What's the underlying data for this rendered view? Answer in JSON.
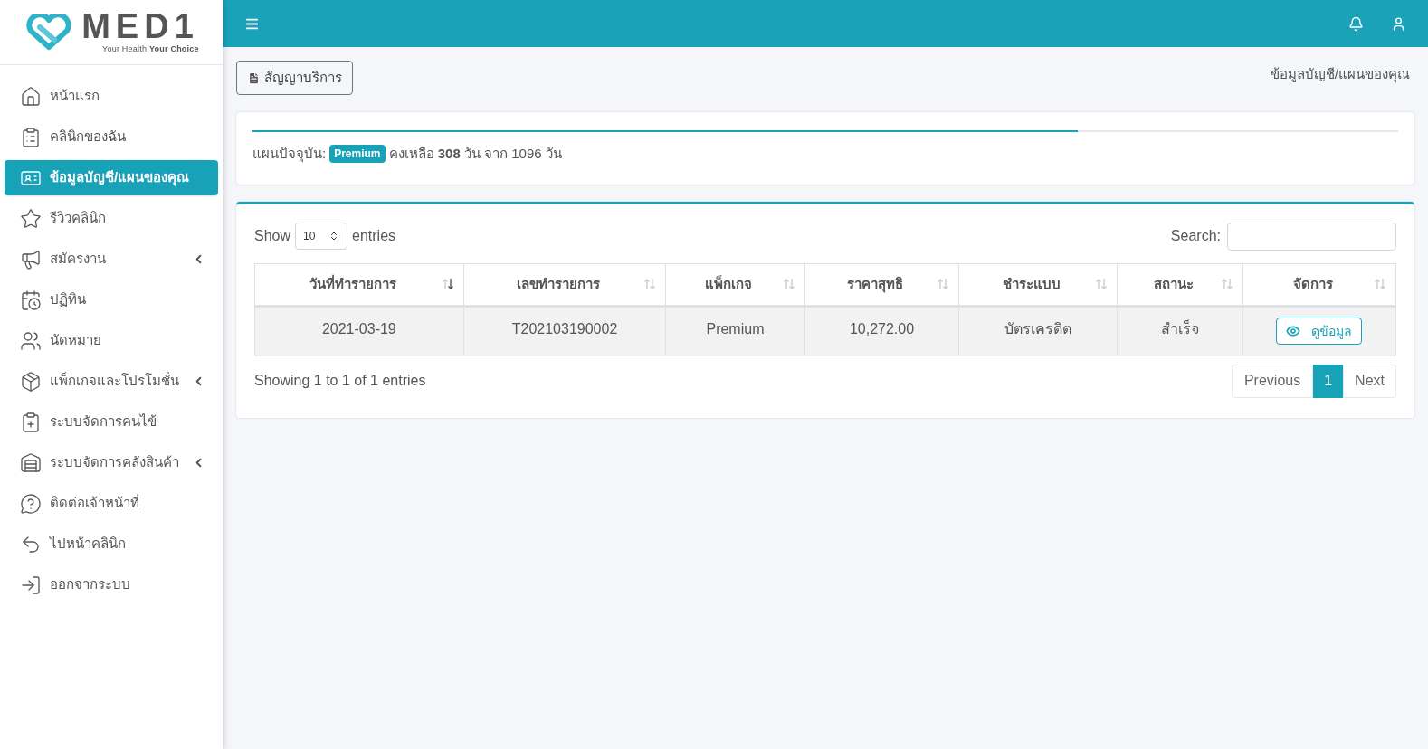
{
  "logo": {
    "name": "MED1",
    "tagline": "Your Health **Your Choice**"
  },
  "sidebar": {
    "items": [
      {
        "label": "หน้าแรก",
        "selected": false,
        "has_submenu": false
      },
      {
        "label": "คลินิกของฉัน",
        "selected": false,
        "has_submenu": false
      },
      {
        "label": "ข้อมูลบัญชี/แผนของคุณ",
        "selected": true,
        "has_submenu": false
      },
      {
        "label": "รีวิวคลินิก",
        "selected": false,
        "has_submenu": false
      },
      {
        "label": "สมัครงาน",
        "selected": false,
        "has_submenu": true
      },
      {
        "label": "ปฏิทิน",
        "selected": false,
        "has_submenu": false
      },
      {
        "label": "นัดหมาย",
        "selected": false,
        "has_submenu": false
      },
      {
        "label": "แพ็กเกจและโปรโมชั่น",
        "selected": false,
        "has_submenu": true
      },
      {
        "label": "ระบบจัดการคนไข้",
        "selected": false,
        "has_submenu": false
      },
      {
        "label": "ระบบจัดการคลังสินค้า",
        "selected": false,
        "has_submenu": true
      },
      {
        "label": "ติดต่อเจ้าหน้าที่",
        "selected": false,
        "has_submenu": false
      },
      {
        "label": "ไปหน้าคลินิก",
        "selected": false,
        "has_submenu": false
      },
      {
        "label": "ออกจากระบบ",
        "selected": false,
        "has_submenu": false
      }
    ]
  },
  "page": {
    "contract_button": "สัญญาบริการ",
    "breadcrumb": "ข้อมูลบัญชี/แผนของคุณ"
  },
  "plan": {
    "level": 0.72,
    "label": "แผนปัจจุบัน:",
    "badge": "Premium",
    "remaining": "คงเหลือ **308** วัน จาก 1096 วัน"
  },
  "table": {
    "show_label": "Show",
    "page_size": "10",
    "entries_label": "entries",
    "search_label": "Search:",
    "columns": [
      {
        "label": "วันที่ทำรายการ",
        "sorted": true
      },
      {
        "label": "เลขทำรายการ",
        "sorted": false
      },
      {
        "label": "แพ็กเกจ",
        "sorted": false
      },
      {
        "label": "ราคาสุทธิ",
        "sorted": false
      },
      {
        "label": "ชำระแบบ",
        "sorted": false
      },
      {
        "label": "สถานะ",
        "sorted": false
      },
      {
        "label": "จัดการ",
        "sorted": false
      }
    ],
    "rows": [
      {
        "cells": [
          "2021-03-19",
          "T202103190002",
          "Premium",
          "10,272.00",
          "บัตรเครดิต",
          "สำเร็จ"
        ],
        "action": "ดูข้อมูล"
      }
    ],
    "info": "Showing 1 to 1 of 1 entries",
    "pagination": {
      "previous": "Previous",
      "pages": [
        {
          "label": "1",
          "selected": true
        }
      ],
      "next": "Next"
    }
  }
}
